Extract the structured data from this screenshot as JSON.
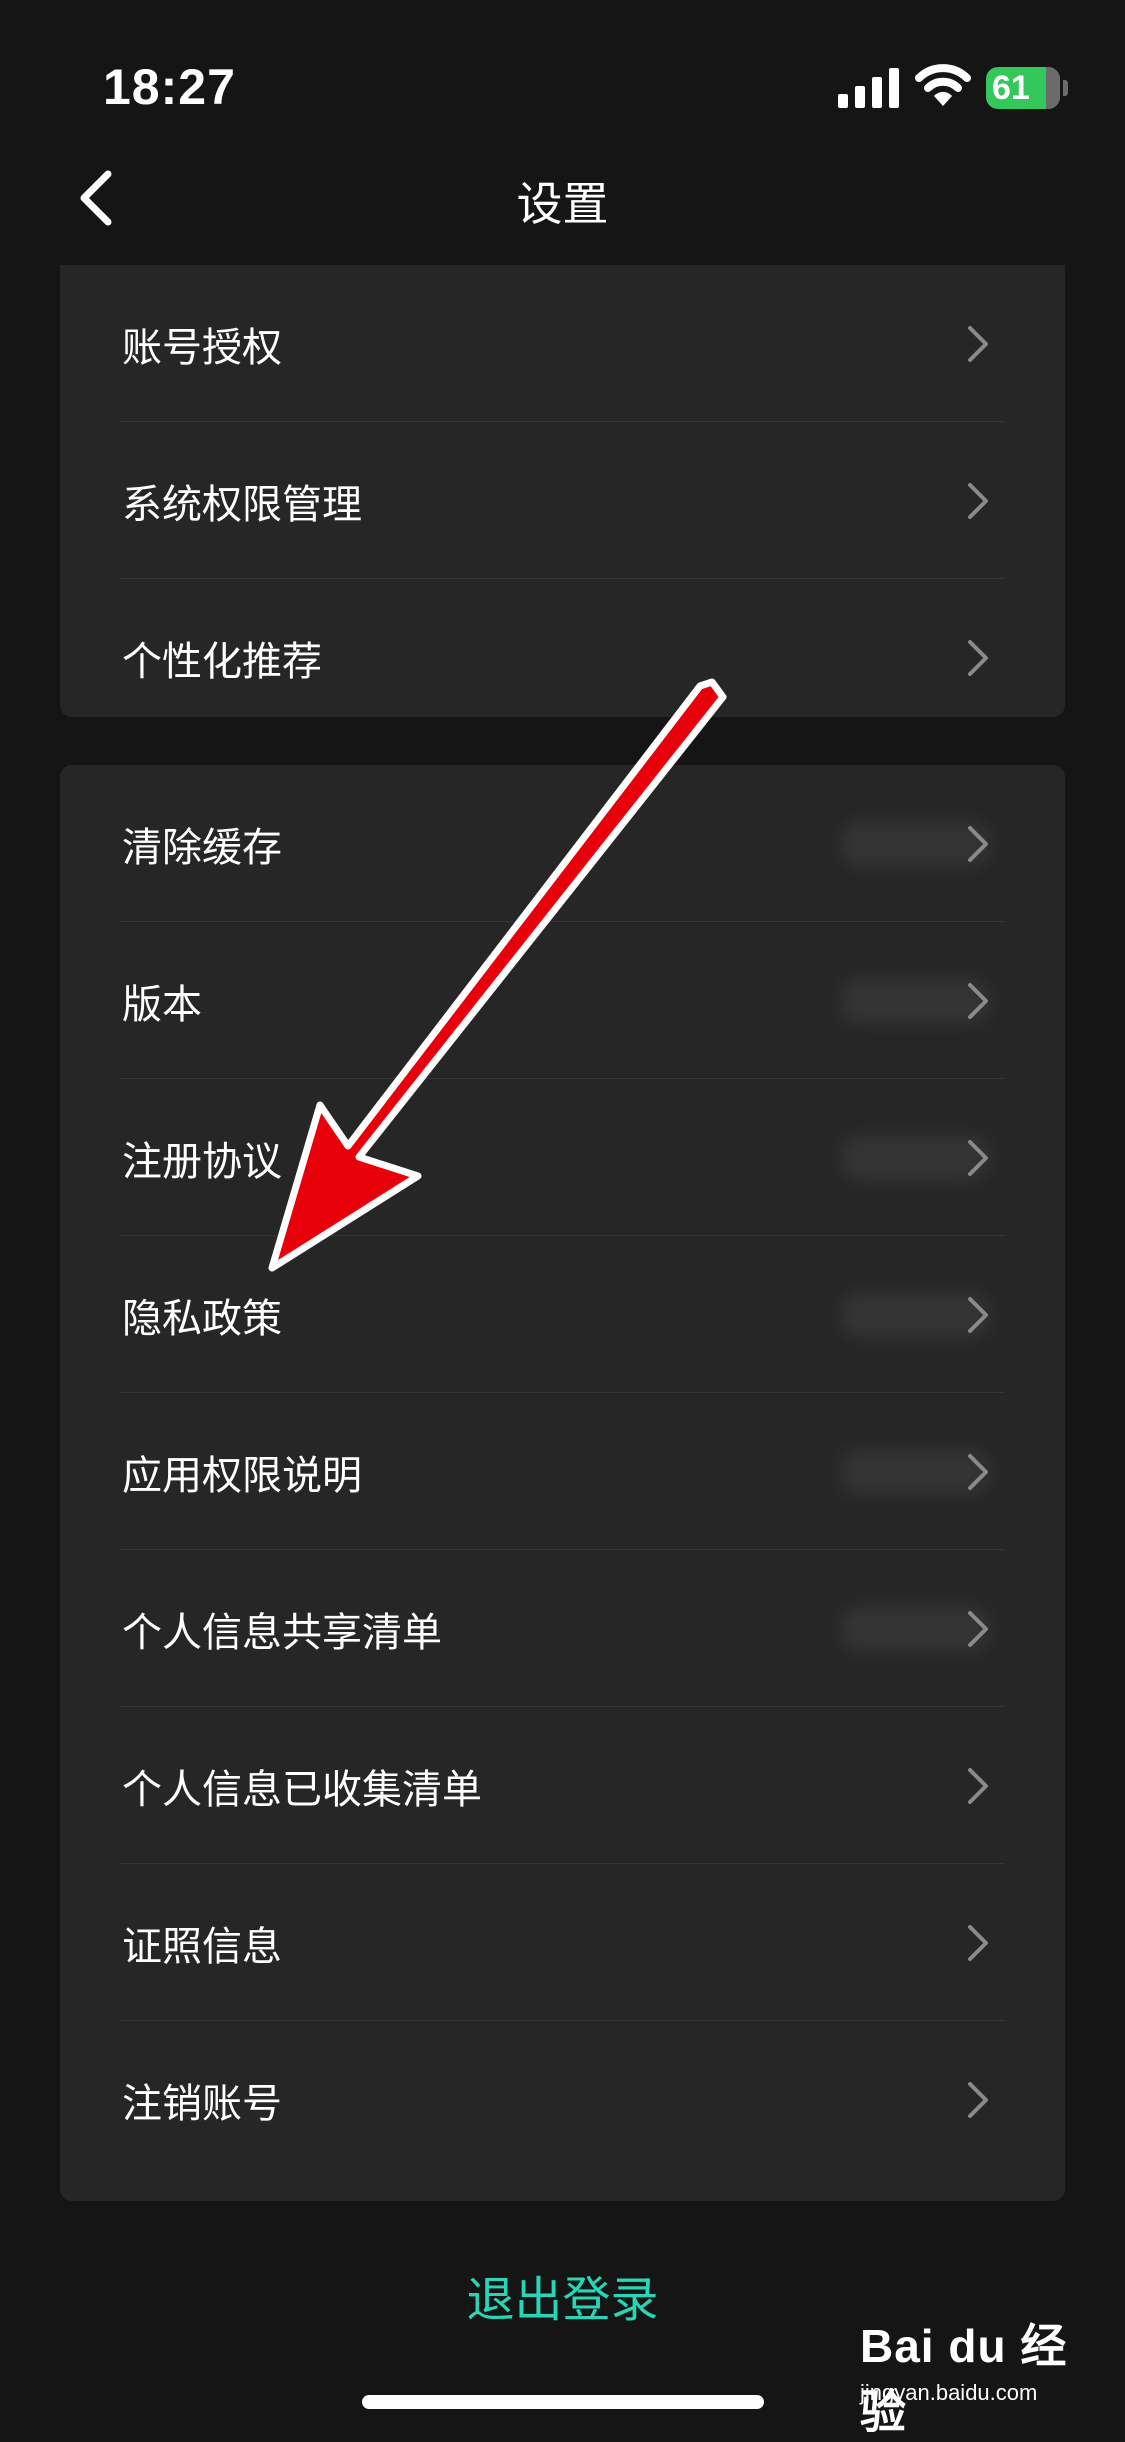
{
  "status_bar": {
    "time": "18:27",
    "battery_level": "61",
    "battery_color": "#34c759",
    "icons": [
      "signal-icon",
      "wifi-icon",
      "battery-charging-icon"
    ]
  },
  "nav": {
    "title": "设置",
    "back_icon": "chevron-left-icon"
  },
  "section1": {
    "items": [
      {
        "label": "账号授权"
      },
      {
        "label": "系统权限管理"
      },
      {
        "label": "个性化推荐"
      }
    ]
  },
  "section2": {
    "items": [
      {
        "label": "清除缓存",
        "value_blurred": true
      },
      {
        "label": "版本",
        "value_blurred": true
      },
      {
        "label": "注册协议",
        "value_blurred": true
      },
      {
        "label": "隐私政策",
        "value_blurred": true
      },
      {
        "label": "应用权限说明",
        "value_blurred": true
      },
      {
        "label": "个人信息共享清单",
        "value_blurred": true
      },
      {
        "label": "个人信息已收集清单"
      },
      {
        "label": "证照信息"
      },
      {
        "label": "注销账号"
      }
    ]
  },
  "logout": {
    "label": "退出登录",
    "color": "#27d6b6"
  },
  "annotation": {
    "arrow_color": "#e8000b",
    "target": "隐私政策"
  },
  "watermark": {
    "brand": "Bai du 经验",
    "url": "jingyan.baidu.com"
  }
}
